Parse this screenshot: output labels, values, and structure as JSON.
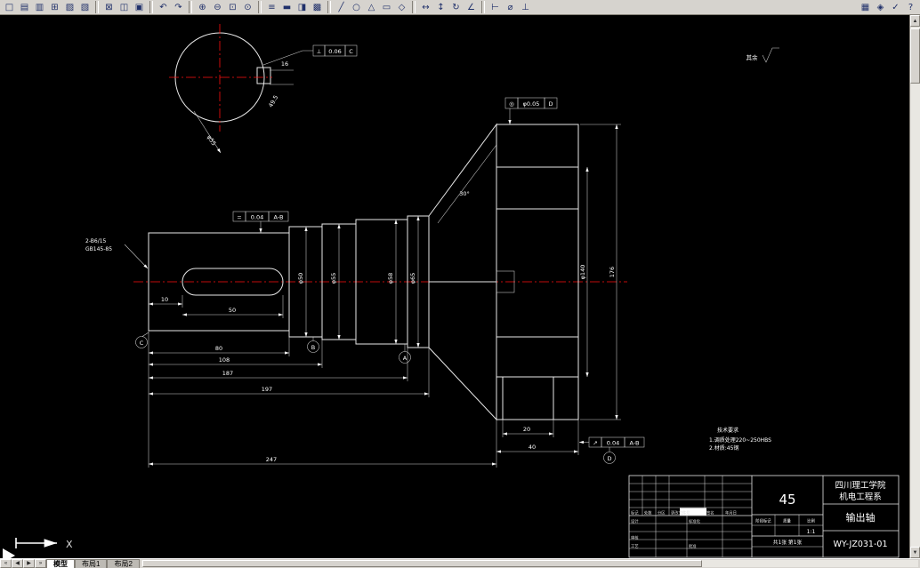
{
  "toolbar": {
    "groups": [
      {
        "buttons": [
          {
            "name": "new",
            "glyph": "□"
          },
          {
            "name": "open",
            "glyph": "▤"
          },
          {
            "name": "save",
            "glyph": "▥"
          },
          {
            "name": "print",
            "glyph": "⊞"
          },
          {
            "name": "print-preview",
            "glyph": "▨"
          },
          {
            "name": "find",
            "glyph": "▧"
          }
        ]
      },
      {
        "buttons": [
          {
            "name": "cut",
            "glyph": "⊠"
          },
          {
            "name": "copy",
            "glyph": "◫"
          },
          {
            "name": "paste",
            "glyph": "▣"
          }
        ]
      },
      {
        "buttons": [
          {
            "name": "undo",
            "glyph": "↶"
          },
          {
            "name": "redo",
            "glyph": "↷"
          }
        ]
      },
      {
        "buttons": [
          {
            "name": "zoom-in",
            "glyph": "⊕"
          },
          {
            "name": "zoom-out",
            "glyph": "⊖"
          },
          {
            "name": "zoom-window",
            "glyph": "⊡"
          },
          {
            "name": "zoom-extents",
            "glyph": "⊙"
          }
        ]
      },
      {
        "buttons": [
          {
            "name": "layers",
            "glyph": "≡"
          },
          {
            "name": "line-weight",
            "glyph": "▬"
          },
          {
            "name": "color-control",
            "glyph": "◨"
          },
          {
            "name": "hatch",
            "glyph": "▩"
          }
        ]
      },
      {
        "buttons": [
          {
            "name": "line",
            "glyph": "╱"
          },
          {
            "name": "circle",
            "glyph": "○"
          },
          {
            "name": "polygon",
            "glyph": "△"
          },
          {
            "name": "rectangle",
            "glyph": "▭"
          },
          {
            "name": "ellipse",
            "glyph": "◇"
          }
        ]
      },
      {
        "buttons": [
          {
            "name": "move",
            "glyph": "↔"
          },
          {
            "name": "stretch",
            "glyph": "↕"
          },
          {
            "name": "rotate",
            "glyph": "↻"
          },
          {
            "name": "measure-angle",
            "glyph": "∠"
          }
        ]
      },
      {
        "buttons": [
          {
            "name": "dim-linear",
            "glyph": "⊢"
          },
          {
            "name": "dim-diameter",
            "glyph": "⌀"
          },
          {
            "name": "tolerance",
            "glyph": "⊥"
          }
        ]
      },
      {
        "align": "right",
        "buttons": [
          {
            "name": "properties",
            "glyph": "▦"
          },
          {
            "name": "render",
            "glyph": "◈"
          },
          {
            "name": "spell-check",
            "glyph": "✓"
          },
          {
            "name": "help",
            "glyph": "?"
          }
        ]
      }
    ]
  },
  "scrollbar": {
    "up": "▲",
    "down": "▼"
  },
  "tabs": {
    "nav": [
      "«",
      "◀",
      "▶",
      "»"
    ],
    "items": [
      "模型",
      "布局1",
      "布局2"
    ],
    "active_index": 0
  },
  "ucs": {
    "x_label": "X"
  },
  "drawing": {
    "surface_note": {
      "label": "其余"
    },
    "tech": {
      "title": "技术要求",
      "line1": "1.调质处理220~250HBS",
      "line2": "2.材质:45钢"
    },
    "dims": {
      "d10": "10",
      "d50": "50",
      "d80": "80",
      "d108": "108",
      "d187": "187",
      "d197": "197",
      "d247": "247",
      "d20": "20",
      "d40": "40",
      "d176": "176",
      "dia50": "φ50",
      "dia55": "φ55",
      "dia58": "φ58",
      "dia65": "φ65",
      "dia140": "φ140",
      "circle_dia": "φ55",
      "key_w": "16",
      "key_d": "49.5",
      "angle": "30°",
      "note1": "2-B6/15",
      "note2": "GB145-85"
    },
    "datums": {
      "a": "A",
      "b": "B",
      "c": "C",
      "d": "D"
    },
    "tol": {
      "t1": {
        "sym": "⊥",
        "val": "0.06",
        "ref": "C"
      },
      "t2": {
        "sym": "=",
        "val": "0.04",
        "ref": "A-B"
      },
      "t3": {
        "sym": "◎",
        "val": "φ0.05",
        "ref": "D"
      },
      "t4": {
        "sym": "↗",
        "val": "0.04",
        "ref": "A-B"
      }
    }
  },
  "titleblock": {
    "material": "45",
    "org_line1": "四川理工学院",
    "org_line2": "机电工程系",
    "part_name": "输出轴",
    "drawing_no": "WY-JZ031-01",
    "stage_label": "阶段标记",
    "mass_label": "质量",
    "scale_label": "比例",
    "scale": "1:1",
    "sheet": "共1张 第1张",
    "rows": {
      "mark": "标记",
      "count": "处数",
      "zone": "分区",
      "doc": "更改文件号",
      "sign": "签名",
      "date": "年月日",
      "design": "设计",
      "standard": "标准化",
      "check": "审核",
      "process": "工艺",
      "approve": "批准"
    }
  }
}
